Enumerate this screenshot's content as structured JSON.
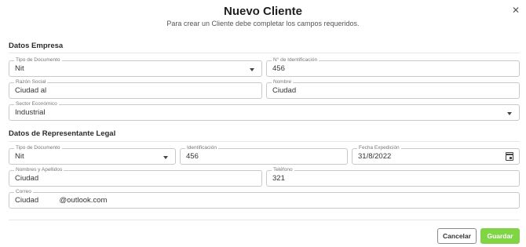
{
  "header": {
    "title": "Nuevo Cliente",
    "subtitle": "Para crear un Cliente debe completar los campos requeridos."
  },
  "empresa": {
    "section_title": "Datos Empresa",
    "tipo_documento": {
      "label": "Tipo de Documento",
      "value": "Nit"
    },
    "identificacion": {
      "label": "N° de Identificación",
      "value": "456"
    },
    "razon_social": {
      "label": "Razón Social",
      "value": "Ciudad al"
    },
    "nombre": {
      "label": "Nombre",
      "value": "Ciudad"
    },
    "sector": {
      "label": "Sector Económico",
      "value": "Industrial"
    }
  },
  "representante": {
    "section_title": "Datos de Representante Legal",
    "tipo_documento": {
      "label": "Tipo de Documento",
      "value": "Nit"
    },
    "identificacion": {
      "label": "Identificación",
      "value": "456"
    },
    "fecha_expedicion": {
      "label": "Fecha Expedición",
      "value": "31/8/2022"
    },
    "nombres": {
      "label": "Nombres y Apellidos",
      "value": "Ciudad"
    },
    "telefono": {
      "label": "Teléfono",
      "value": "321"
    },
    "correo": {
      "label": "Correo",
      "value": "Ciudad          @outlook.com"
    }
  },
  "footer": {
    "cancel_label": "Cancelar",
    "save_label": "Guardar"
  },
  "colors": {
    "save_button": "#80d544",
    "border": "#c9c9c9"
  },
  "icons": {
    "close": "close-icon",
    "dropdown": "chevron-down-icon",
    "calendar": "calendar-icon"
  }
}
